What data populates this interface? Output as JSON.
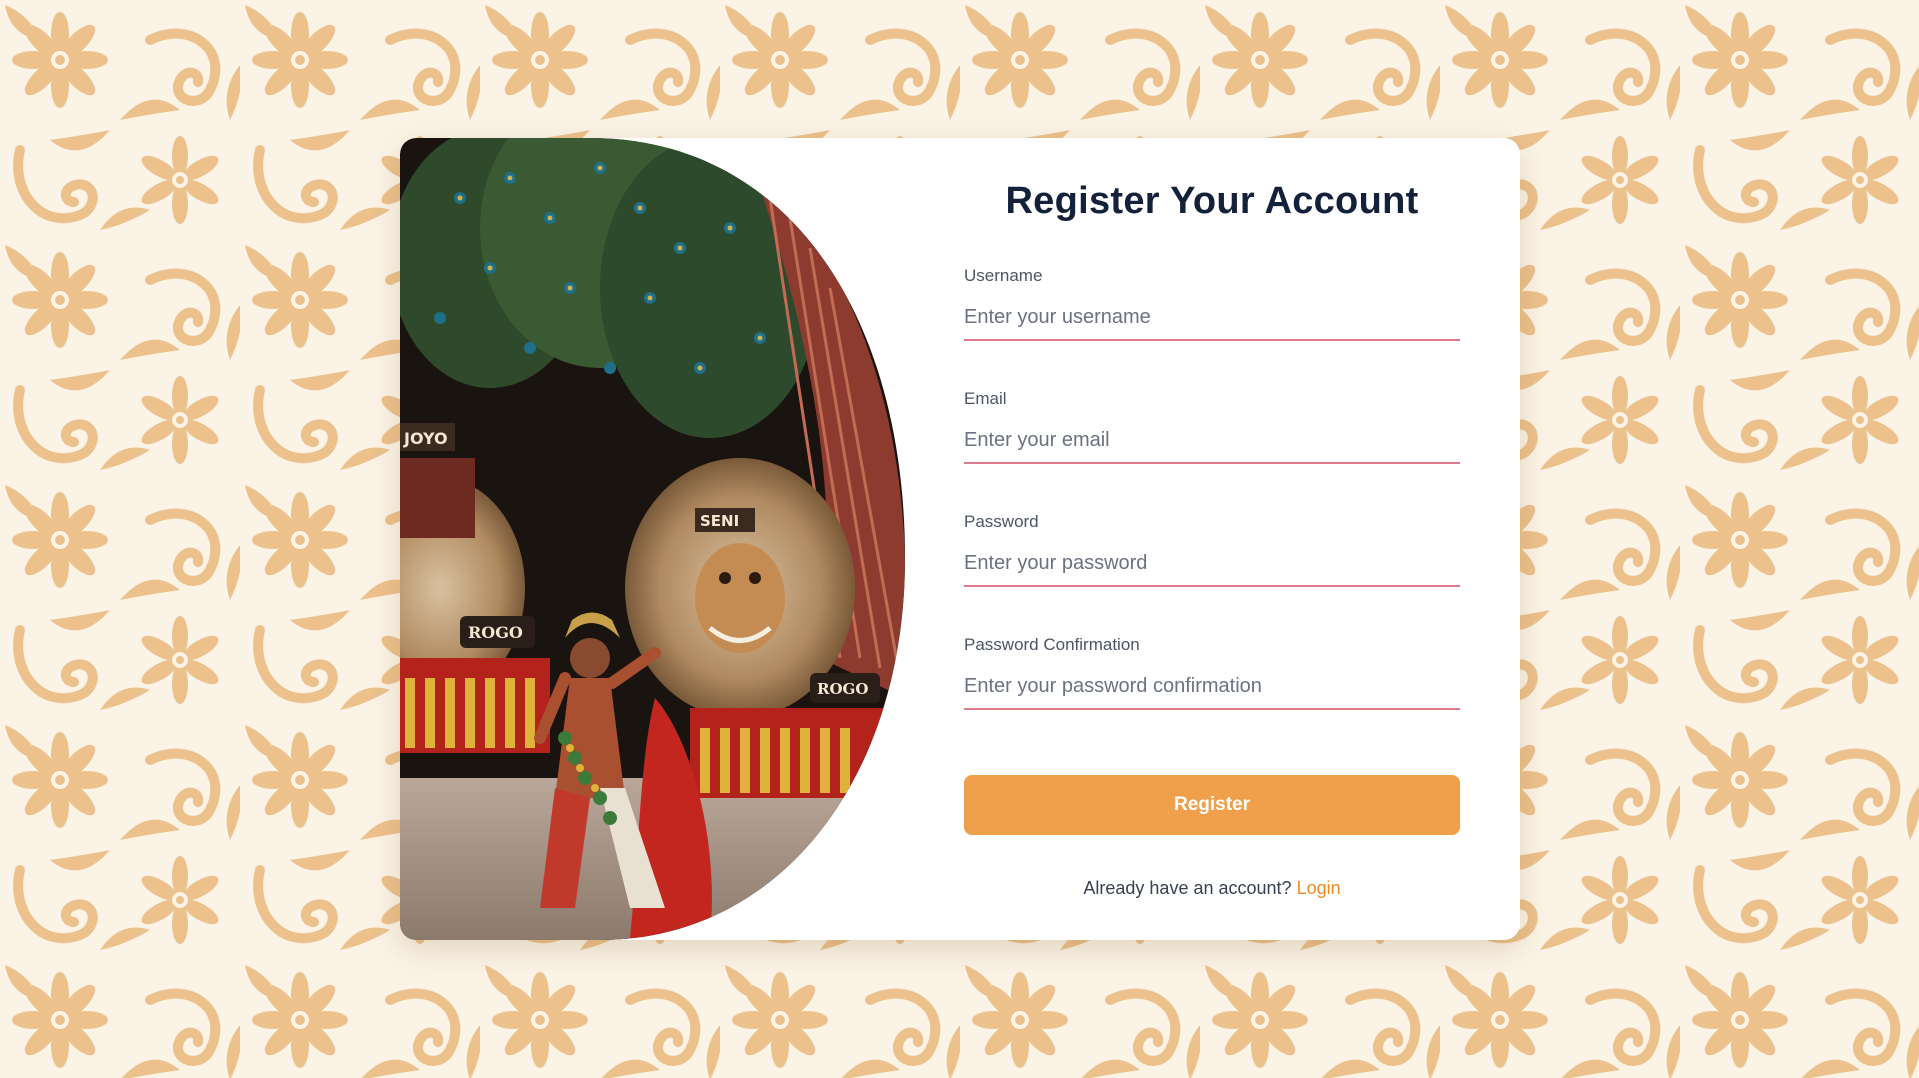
{
  "form": {
    "title": "Register Your Account",
    "fields": [
      {
        "label": "Username",
        "placeholder": "Enter your username",
        "value": ""
      },
      {
        "label": "Email",
        "placeholder": "Enter your email",
        "value": ""
      },
      {
        "label": "Password",
        "placeholder": "Enter your password",
        "value": ""
      },
      {
        "label": "Password Confirmation",
        "placeholder": "Enter your password confirmation",
        "value": ""
      }
    ],
    "submit_label": "Register",
    "login_prompt": "Already have an account?",
    "login_link": "Login"
  },
  "banner": {
    "sign_texts": [
      "JOYO",
      "SENI",
      "ROGO",
      "ROGO"
    ]
  },
  "colors": {
    "accent": "#f0a04b",
    "link": "#f08a24",
    "input_underline": "#e07a8a",
    "title": "#14213a",
    "background_pattern": "#ecc18c"
  }
}
